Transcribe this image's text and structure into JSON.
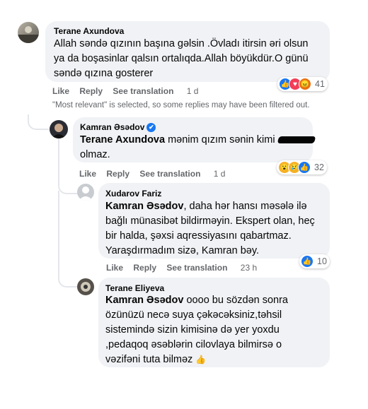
{
  "comments": [
    {
      "author": "Terane Axundova",
      "lines": [
        "Allah səndə qızının başına gəlsin .Övladı itirsin əri olsun",
        "ya da boşasinlar qalsın ortalıqda.Allah böyükdür.O günü",
        "səndə qızına gosterer"
      ],
      "actions": {
        "like": "Like",
        "reply": "Reply",
        "translate": "See translation",
        "time": "1 d"
      },
      "reaction_count": "41",
      "reaction_icons": [
        "like-icon",
        "love-icon",
        "angry-icon"
      ]
    },
    {
      "author": "Kamran Əsədov",
      "verified": "✔",
      "mention": "Terane Axundova",
      "line1_text": " mənim qızım sənin kimi ",
      "line2": "olmaz.",
      "actions": {
        "like": "Like",
        "reply": "Reply",
        "translate": "See translation",
        "time": "1 d"
      },
      "reaction_count": "32",
      "reaction_icons": [
        "wow-icon",
        "sad-icon",
        "like-icon"
      ]
    },
    {
      "author": "Xudarov Fariz",
      "mention": "Kamran Əsədov",
      "line1_text": ", daha hər hansı məsələ ilə",
      "lines": [
        "bağlı münasibət bildirməyin. Ekspert olan, heç",
        "bir halda, şəxsi aqressiyasını qabartmaz.",
        "Yaraşdırmadım sizə, Kamran bəy."
      ],
      "actions": {
        "like": "Like",
        "reply": "Reply",
        "translate": "See translation",
        "time": "23 h"
      },
      "reaction_count": "10",
      "reaction_icons": [
        "like-icon"
      ]
    },
    {
      "author": "Terane Eliyeva",
      "mention": "Kamran Əsədov",
      "line1_text": " oooo bu sözdən sonra",
      "lines": [
        "özünüzü necə suya çəkəcəksiniz,təhsil",
        "sistemində sizin kimisinə də yer yoxdu",
        ",pedaqoq əsəblərin cilovlaya bilmirsə o",
        "vəzifəni tuta bilməz"
      ],
      "emoji": "👍"
    }
  ],
  "notice": "\"Most relevant\" is selected, so some replies may have been filtered out."
}
